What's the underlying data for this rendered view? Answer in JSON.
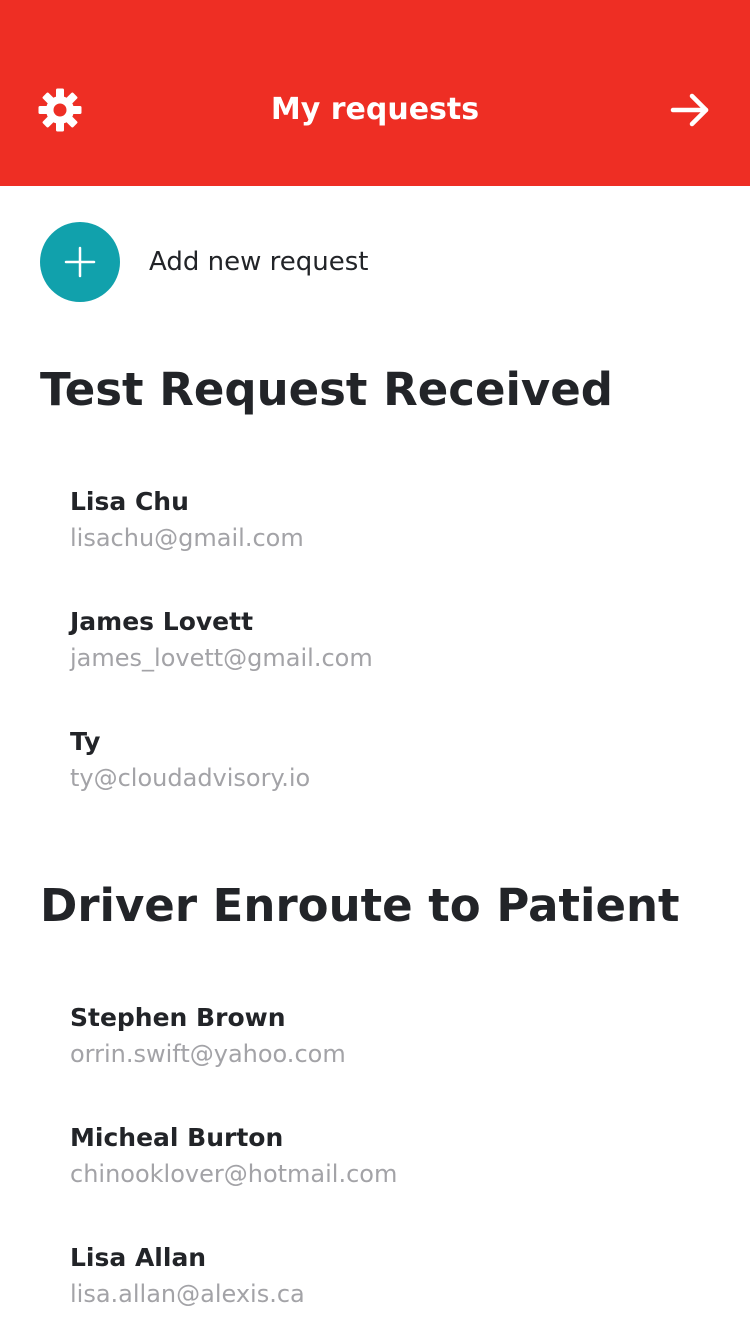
{
  "header": {
    "title": "My requests",
    "left_icon": "gear-icon",
    "right_icon": "arrow-right-icon",
    "background_color": "#ee2e24"
  },
  "add_request": {
    "label": "Add new request",
    "icon": "plus-icon",
    "accent_color": "#11a1ac"
  },
  "sections": [
    {
      "title": "Test Request Received",
      "people": [
        {
          "name": "Lisa Chu",
          "email": "lisachu@gmail.com"
        },
        {
          "name": "James Lovett",
          "email": "james_lovett@gmail.com"
        },
        {
          "name": "Ty",
          "email": "ty@cloudadvisory.io"
        }
      ]
    },
    {
      "title": "Driver Enroute to Patient",
      "people": [
        {
          "name": "Stephen Brown",
          "email": "orrin.swift@yahoo.com"
        },
        {
          "name": "Micheal Burton",
          "email": "chinooklover@hotmail.com"
        },
        {
          "name": "Lisa Allan",
          "email": "lisa.allan@alexis.ca"
        }
      ]
    }
  ]
}
